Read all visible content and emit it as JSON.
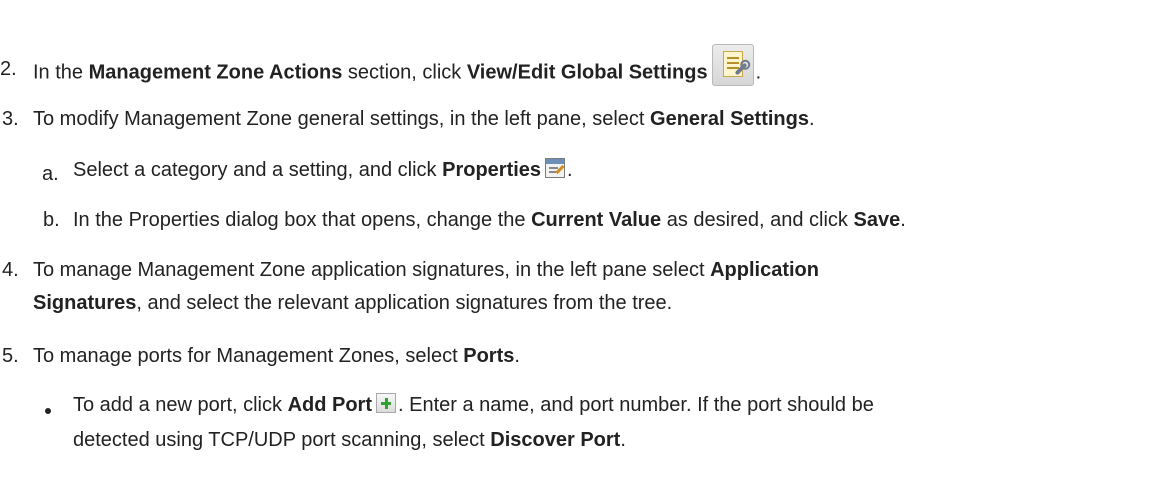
{
  "steps": {
    "s2": {
      "number": "2.",
      "pre": "In the ",
      "b1": "Management Zone Actions",
      "mid": " section, click ",
      "b2": "View/Edit Global Settings",
      "post": ".",
      "icon": "global-settings-icon"
    },
    "s3": {
      "number": "3.",
      "pre": "To modify Management Zone general settings, in the left pane, select ",
      "b1": "General Settings",
      "post": "."
    },
    "s3a": {
      "number": "a.",
      "pre": "Select a category and a setting, and click ",
      "b1": "Properties",
      "post": ".",
      "icon": "properties-icon"
    },
    "s3b": {
      "number": "b.",
      "pre": "In the Properties dialog box that opens, change the ",
      "b1": "Current Value",
      "mid": " as desired, and click ",
      "b2": "Save",
      "post": "."
    },
    "s4": {
      "number": "4.",
      "line1_pre": "To manage Management Zone application signatures, in the left pane select ",
      "line1_b": "Application",
      "line2_b": "Signatures",
      "line2_post": ", and select the relevant application signatures from the tree."
    },
    "s5": {
      "number": "5.",
      "pre": "To manage ports for Management Zones, select ",
      "b1": "Ports",
      "post": "."
    },
    "s5_bullet": {
      "line1_pre": "To add a new port, click ",
      "line1_b": "Add Port",
      "line1_post": ". Enter a name, and port number. If the port should be",
      "line2_pre": "detected using TCP/UDP port scanning, select ",
      "line2_b": "Discover Port",
      "line2_post": ".",
      "icon": "add-port-icon"
    }
  }
}
